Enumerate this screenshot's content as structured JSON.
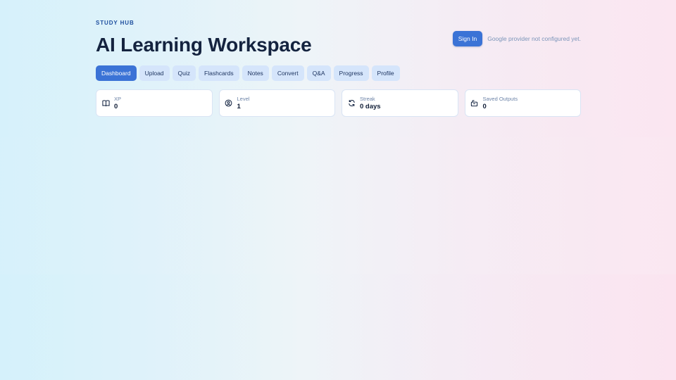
{
  "header": {
    "eyebrow": "STUDY HUB",
    "title": "AI Learning Workspace"
  },
  "auth": {
    "sign_in_label": "Sign In",
    "note": "Google provider not configured yet."
  },
  "nav": {
    "tabs": [
      {
        "label": "Dashboard",
        "active": true
      },
      {
        "label": "Upload"
      },
      {
        "label": "Quiz"
      },
      {
        "label": "Flashcards"
      },
      {
        "label": "Notes"
      },
      {
        "label": "Convert"
      },
      {
        "label": "Q&A"
      },
      {
        "label": "Progress"
      },
      {
        "label": "Profile"
      }
    ]
  },
  "stats": [
    {
      "icon": "book-icon",
      "label": "XP",
      "value": "0"
    },
    {
      "icon": "user-circle-icon",
      "label": "Level",
      "value": "1"
    },
    {
      "icon": "refresh-icon",
      "label": "Streak",
      "value": "0 days"
    },
    {
      "icon": "archive-icon",
      "label": "Saved Outputs",
      "value": "0"
    }
  ],
  "colors": {
    "accent": "#3b73d6",
    "tab_bg": "#d5e5fb",
    "title": "#14233f",
    "eyebrow": "#1d4e9e"
  }
}
